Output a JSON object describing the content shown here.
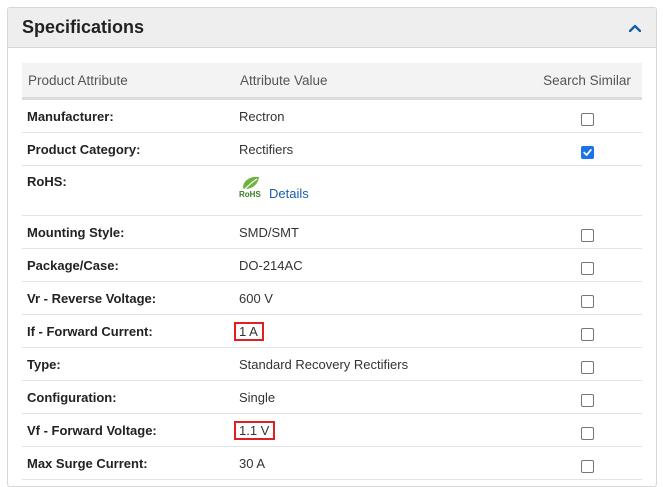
{
  "panel": {
    "title": "Specifications"
  },
  "table": {
    "headers": [
      "Product Attribute",
      "Attribute Value",
      "Search Similar"
    ],
    "rows": [
      {
        "attr": "Manufacturer:",
        "value": "Rectron",
        "checked": false
      },
      {
        "attr": "Product Category:",
        "value": "Rectifiers",
        "checked": true
      },
      {
        "attr": "RoHS:",
        "value": "Details",
        "rohs_logo": "RoHS",
        "checked": null
      },
      {
        "attr": "Mounting Style:",
        "value": "SMD/SMT",
        "checked": false
      },
      {
        "attr": "Package/Case:",
        "value": "DO-214AC",
        "checked": false
      },
      {
        "attr": "Vr - Reverse Voltage:",
        "value": "600 V",
        "checked": false
      },
      {
        "attr": "If - Forward Current:",
        "value": "1 A",
        "checked": false,
        "highlighted": true
      },
      {
        "attr": "Type:",
        "value": "Standard Recovery Rectifiers",
        "checked": false
      },
      {
        "attr": "Configuration:",
        "value": "Single",
        "checked": false
      },
      {
        "attr": "Vf - Forward Voltage:",
        "value": "1.1 V",
        "checked": false,
        "highlighted": true
      },
      {
        "attr": "Max Surge Current:",
        "value": "30 A",
        "checked": false
      }
    ]
  },
  "colors": {
    "highlight_border": "#e02020",
    "checkbox_checked": "#1a73e8",
    "link": "#1a5ea8",
    "header_bg": "#eeeeee"
  }
}
